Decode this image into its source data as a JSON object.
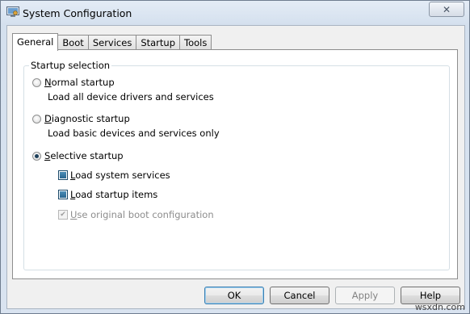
{
  "window": {
    "title": "System Configuration",
    "close_glyph": "✕",
    "icon": "system-config-icon"
  },
  "tabs": [
    {
      "label": "General",
      "active": true
    },
    {
      "label": "Boot",
      "active": false
    },
    {
      "label": "Services",
      "active": false
    },
    {
      "label": "Startup",
      "active": false
    },
    {
      "label": "Tools",
      "active": false
    }
  ],
  "startup_selection": {
    "legend": "Startup selection",
    "options": [
      {
        "label_key": "N",
        "label_rest": "ormal startup",
        "description": "Load all device drivers and services",
        "checked": false
      },
      {
        "label_key": "D",
        "label_rest": "iagnostic startup",
        "description": "Load basic devices and services only",
        "checked": false
      },
      {
        "label_key": "S",
        "label_rest": "elective startup",
        "description": "",
        "checked": true
      }
    ],
    "sub_options": [
      {
        "label_key": "L",
        "label_rest": "oad system services",
        "state": "indeterminate",
        "enabled": true
      },
      {
        "label_key": "L",
        "label_rest": "oad startup items",
        "state": "indeterminate",
        "enabled": true
      },
      {
        "label_key": "U",
        "label_rest": "se original boot configuration",
        "state": "checked",
        "enabled": false
      }
    ]
  },
  "buttons": {
    "ok": "OK",
    "cancel": "Cancel",
    "apply": "Apply",
    "help": "Help"
  },
  "watermark": "wsxdn.com"
}
